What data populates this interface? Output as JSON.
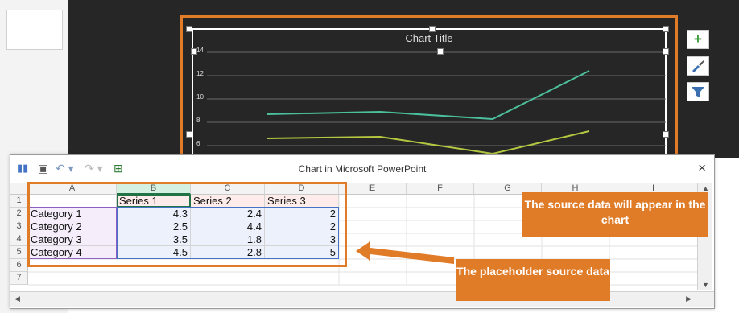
{
  "chart": {
    "title": "Chart Title",
    "y_ticks": [
      "14",
      "12",
      "10",
      "8",
      "6"
    ],
    "line_colors": {
      "series_1": "#4bbf9b",
      "series_2": "#b5c840"
    },
    "side_buttons": {
      "add_icon": "plus-icon",
      "style_icon": "brush-icon",
      "filter_icon": "funnel-icon"
    }
  },
  "window": {
    "title": "Chart in Microsoft PowerPoint",
    "close": "×",
    "columns": [
      "A",
      "B",
      "C",
      "D",
      "E",
      "F",
      "G",
      "H",
      "I"
    ],
    "rows": [
      "1",
      "2",
      "3",
      "4",
      "5",
      "6",
      "7"
    ],
    "headers": [
      "",
      "Series 1",
      "Series 2",
      "Series 3"
    ],
    "data": [
      [
        "Category 1",
        "4.3",
        "2.4",
        "2"
      ],
      [
        "Category 2",
        "2.5",
        "4.4",
        "2"
      ],
      [
        "Category 3",
        "3.5",
        "1.8",
        "3"
      ],
      [
        "Category 4",
        "4.5",
        "2.8",
        "5"
      ]
    ]
  },
  "callouts": {
    "chart_source": "The source data will appear in the chart",
    "placeholder": "The placeholder source data"
  },
  "colors": {
    "accent": "#e07b28",
    "chart_bg": "#262626"
  }
}
